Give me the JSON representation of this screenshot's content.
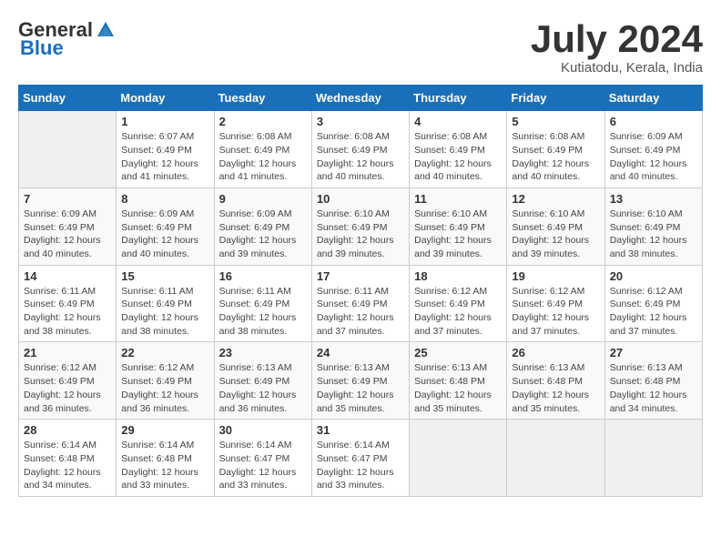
{
  "logo": {
    "general": "General",
    "blue": "Blue"
  },
  "title": "July 2024",
  "location": "Kutiatodu, Kerala, India",
  "days_of_week": [
    "Sunday",
    "Monday",
    "Tuesday",
    "Wednesday",
    "Thursday",
    "Friday",
    "Saturday"
  ],
  "weeks": [
    [
      {
        "day": "",
        "info": ""
      },
      {
        "day": "1",
        "info": "Sunrise: 6:07 AM\nSunset: 6:49 PM\nDaylight: 12 hours\nand 41 minutes."
      },
      {
        "day": "2",
        "info": "Sunrise: 6:08 AM\nSunset: 6:49 PM\nDaylight: 12 hours\nand 41 minutes."
      },
      {
        "day": "3",
        "info": "Sunrise: 6:08 AM\nSunset: 6:49 PM\nDaylight: 12 hours\nand 40 minutes."
      },
      {
        "day": "4",
        "info": "Sunrise: 6:08 AM\nSunset: 6:49 PM\nDaylight: 12 hours\nand 40 minutes."
      },
      {
        "day": "5",
        "info": "Sunrise: 6:08 AM\nSunset: 6:49 PM\nDaylight: 12 hours\nand 40 minutes."
      },
      {
        "day": "6",
        "info": "Sunrise: 6:09 AM\nSunset: 6:49 PM\nDaylight: 12 hours\nand 40 minutes."
      }
    ],
    [
      {
        "day": "7",
        "info": "Sunrise: 6:09 AM\nSunset: 6:49 PM\nDaylight: 12 hours\nand 40 minutes."
      },
      {
        "day": "8",
        "info": "Sunrise: 6:09 AM\nSunset: 6:49 PM\nDaylight: 12 hours\nand 40 minutes."
      },
      {
        "day": "9",
        "info": "Sunrise: 6:09 AM\nSunset: 6:49 PM\nDaylight: 12 hours\nand 39 minutes."
      },
      {
        "day": "10",
        "info": "Sunrise: 6:10 AM\nSunset: 6:49 PM\nDaylight: 12 hours\nand 39 minutes."
      },
      {
        "day": "11",
        "info": "Sunrise: 6:10 AM\nSunset: 6:49 PM\nDaylight: 12 hours\nand 39 minutes."
      },
      {
        "day": "12",
        "info": "Sunrise: 6:10 AM\nSunset: 6:49 PM\nDaylight: 12 hours\nand 39 minutes."
      },
      {
        "day": "13",
        "info": "Sunrise: 6:10 AM\nSunset: 6:49 PM\nDaylight: 12 hours\nand 38 minutes."
      }
    ],
    [
      {
        "day": "14",
        "info": "Sunrise: 6:11 AM\nSunset: 6:49 PM\nDaylight: 12 hours\nand 38 minutes."
      },
      {
        "day": "15",
        "info": "Sunrise: 6:11 AM\nSunset: 6:49 PM\nDaylight: 12 hours\nand 38 minutes."
      },
      {
        "day": "16",
        "info": "Sunrise: 6:11 AM\nSunset: 6:49 PM\nDaylight: 12 hours\nand 38 minutes."
      },
      {
        "day": "17",
        "info": "Sunrise: 6:11 AM\nSunset: 6:49 PM\nDaylight: 12 hours\nand 37 minutes."
      },
      {
        "day": "18",
        "info": "Sunrise: 6:12 AM\nSunset: 6:49 PM\nDaylight: 12 hours\nand 37 minutes."
      },
      {
        "day": "19",
        "info": "Sunrise: 6:12 AM\nSunset: 6:49 PM\nDaylight: 12 hours\nand 37 minutes."
      },
      {
        "day": "20",
        "info": "Sunrise: 6:12 AM\nSunset: 6:49 PM\nDaylight: 12 hours\nand 37 minutes."
      }
    ],
    [
      {
        "day": "21",
        "info": "Sunrise: 6:12 AM\nSunset: 6:49 PM\nDaylight: 12 hours\nand 36 minutes."
      },
      {
        "day": "22",
        "info": "Sunrise: 6:12 AM\nSunset: 6:49 PM\nDaylight: 12 hours\nand 36 minutes."
      },
      {
        "day": "23",
        "info": "Sunrise: 6:13 AM\nSunset: 6:49 PM\nDaylight: 12 hours\nand 36 minutes."
      },
      {
        "day": "24",
        "info": "Sunrise: 6:13 AM\nSunset: 6:49 PM\nDaylight: 12 hours\nand 35 minutes."
      },
      {
        "day": "25",
        "info": "Sunrise: 6:13 AM\nSunset: 6:48 PM\nDaylight: 12 hours\nand 35 minutes."
      },
      {
        "day": "26",
        "info": "Sunrise: 6:13 AM\nSunset: 6:48 PM\nDaylight: 12 hours\nand 35 minutes."
      },
      {
        "day": "27",
        "info": "Sunrise: 6:13 AM\nSunset: 6:48 PM\nDaylight: 12 hours\nand 34 minutes."
      }
    ],
    [
      {
        "day": "28",
        "info": "Sunrise: 6:14 AM\nSunset: 6:48 PM\nDaylight: 12 hours\nand 34 minutes."
      },
      {
        "day": "29",
        "info": "Sunrise: 6:14 AM\nSunset: 6:48 PM\nDaylight: 12 hours\nand 33 minutes."
      },
      {
        "day": "30",
        "info": "Sunrise: 6:14 AM\nSunset: 6:47 PM\nDaylight: 12 hours\nand 33 minutes."
      },
      {
        "day": "31",
        "info": "Sunrise: 6:14 AM\nSunset: 6:47 PM\nDaylight: 12 hours\nand 33 minutes."
      },
      {
        "day": "",
        "info": ""
      },
      {
        "day": "",
        "info": ""
      },
      {
        "day": "",
        "info": ""
      }
    ]
  ]
}
